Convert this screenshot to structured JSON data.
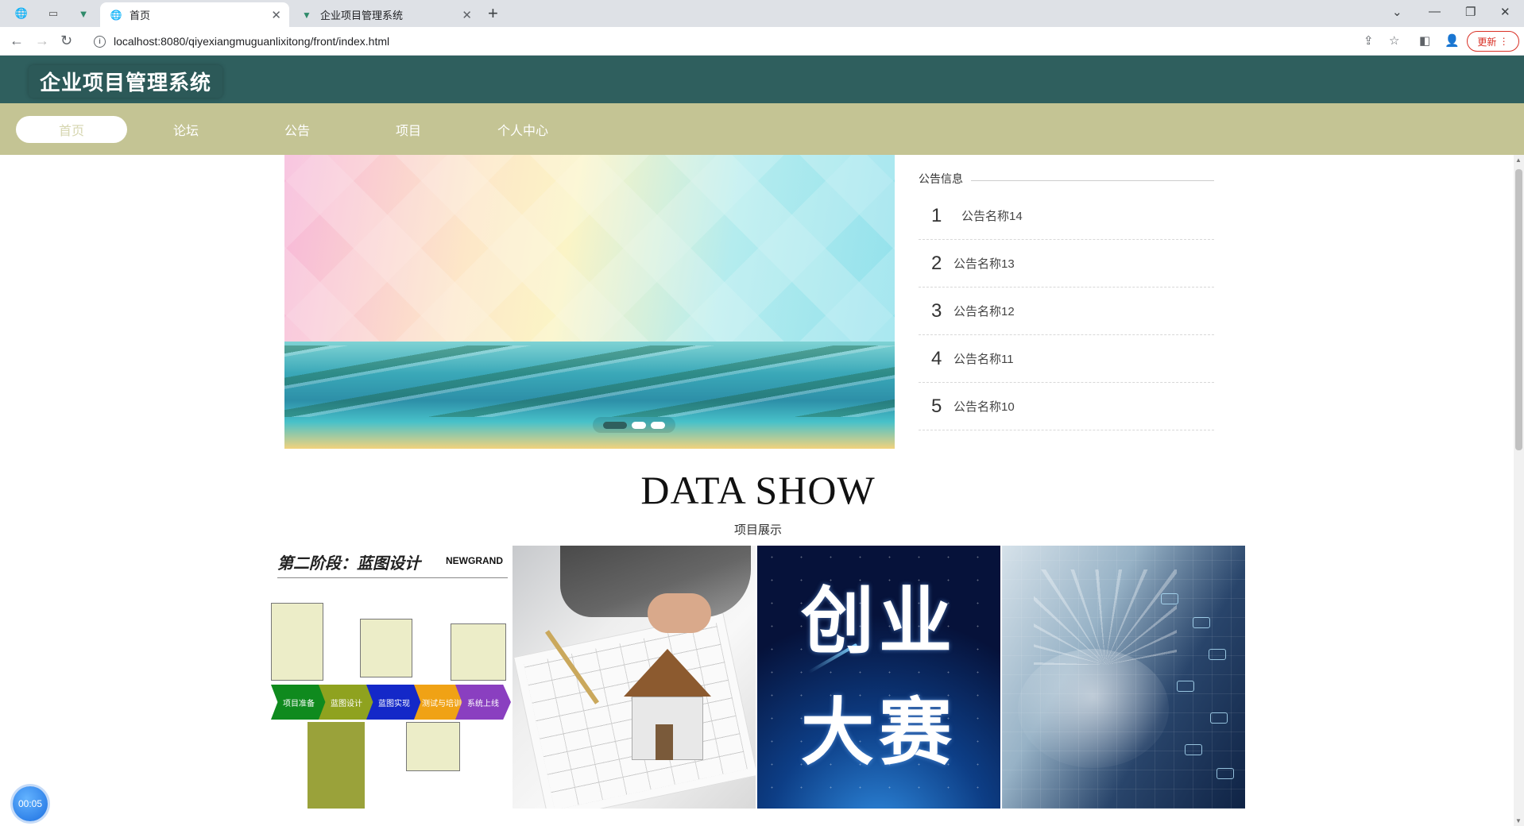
{
  "browser": {
    "tabs": [
      {
        "title": "首页",
        "active": true
      },
      {
        "title": "企业项目管理系统",
        "active": false
      }
    ],
    "url": "localhost:8080/qiyexiangmuguanlixitong/front/index.html",
    "update_label": "更新"
  },
  "site": {
    "title": "企业项目管理系统",
    "nav": [
      "首页",
      "论坛",
      "公告",
      "项目",
      "个人中心"
    ]
  },
  "notice": {
    "heading": "公告信息",
    "items": [
      {
        "num": "1",
        "name": "公告名称14"
      },
      {
        "num": "2",
        "name": "公告名称13"
      },
      {
        "num": "3",
        "name": "公告名称12"
      },
      {
        "num": "4",
        "name": "公告名称11"
      },
      {
        "num": "5",
        "name": "公告名称10"
      }
    ]
  },
  "carousel": {
    "slide_count": 3,
    "active_index": 0
  },
  "data_show": {
    "title": "DATA SHOW",
    "subtitle": "项目展示",
    "gallery": {
      "item1": {
        "header": "第二阶段：蓝图设计",
        "logo": "NEWGRAND",
        "stages": [
          "项目准备",
          "蓝图设计",
          "蓝图实现",
          "测试与培训",
          "系统上线"
        ]
      },
      "item3": {
        "line1": "创业",
        "line2": "大赛"
      }
    }
  },
  "timer": "00:05",
  "colors": {
    "header_bg": "#2f5f5e",
    "nav_bg": "#c4c494",
    "update_red": "#d93025"
  }
}
